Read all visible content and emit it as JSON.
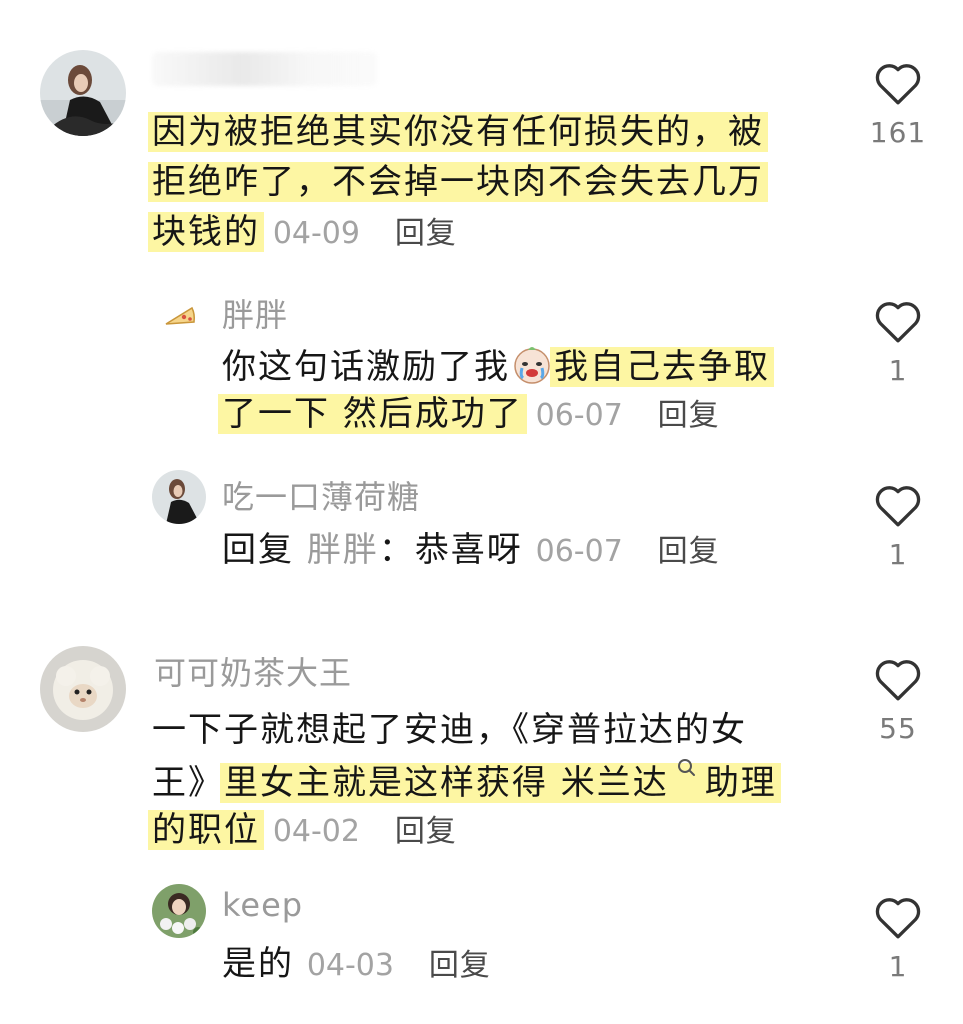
{
  "comments": [
    {
      "username": "",
      "text_lines": [
        "因为被拒绝其实你没有任何损失的，被",
        "拒绝咋了，不会掉一块肉不会失去几万",
        "块钱的"
      ],
      "date": "04-09",
      "reply_label": "回复",
      "likes": "161",
      "replies": [
        {
          "username": "胖胖",
          "text_a": "你这句话激励了我",
          "emoji": "crying-face-emoji",
          "text_b": "我自己去争取",
          "text_c": "了一下  然后成功了",
          "date": "06-07",
          "reply_label": "回复",
          "likes": "1"
        },
        {
          "username": "吃一口薄荷糖",
          "reply_prefix": "回复",
          "mention": "胖胖",
          "colon": "：",
          "text": "恭喜呀",
          "date": "06-07",
          "reply_label": "回复",
          "likes": "1"
        }
      ]
    },
    {
      "username": "可可奶茶大王",
      "text_lines": [
        "一下子就想起了安迪，《穿普拉达的女",
        "王》",
        "里女主就是这样获得 米兰达",
        "助理",
        "的职位"
      ],
      "date": "04-02",
      "reply_label": "回复",
      "likes": "55",
      "replies": [
        {
          "username": "keep",
          "text": "是的",
          "date": "04-03",
          "reply_label": "回复",
          "likes": "1"
        }
      ]
    }
  ],
  "icons": {
    "like": "heart-outline-icon",
    "search": "search-mini-icon",
    "pizza": "pizza-slice-icon"
  },
  "colors": {
    "highlight": "#fdf6a3",
    "meta": "#a3a3a3",
    "username": "#9a9a9a"
  }
}
